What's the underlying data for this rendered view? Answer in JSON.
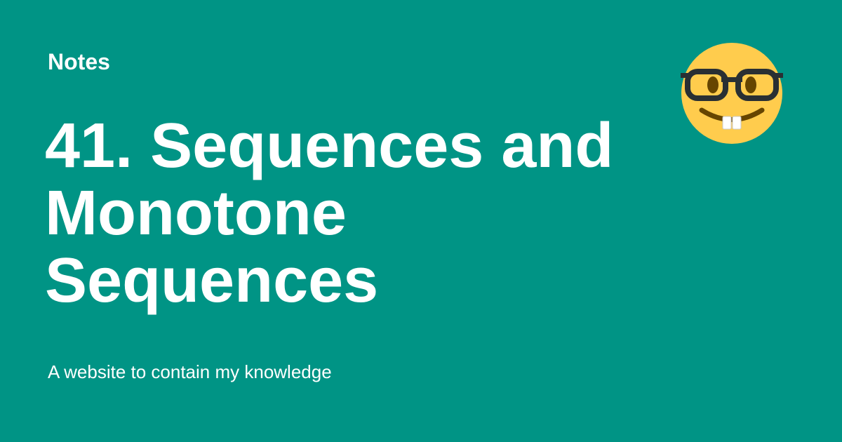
{
  "header": {
    "site_name": "Notes"
  },
  "main": {
    "title_lines": [
      "41. Sequences and",
      "Monotone",
      "Sequences"
    ],
    "tagline": "A website to contain my knowledge"
  },
  "decoration": {
    "icon": "nerd-face-icon"
  },
  "colors": {
    "background": "#009485",
    "text": "#ffffff",
    "emoji_face": "#FFCC4D",
    "emoji_glasses": "#292F33",
    "emoji_eyes": "#664500"
  }
}
